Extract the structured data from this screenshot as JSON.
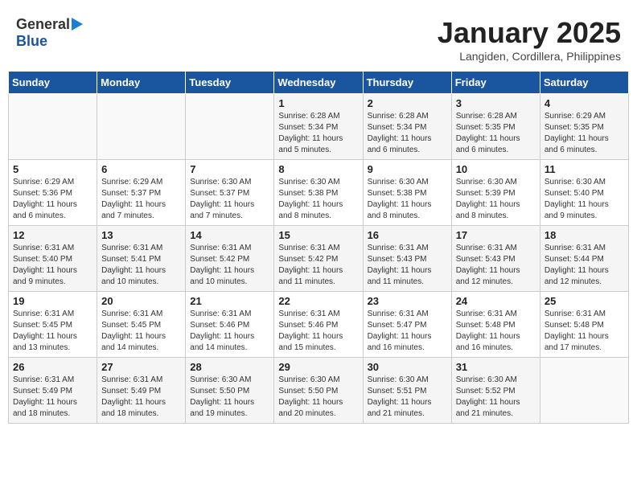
{
  "header": {
    "logo_general": "General",
    "logo_blue": "Blue",
    "month_title": "January 2025",
    "location": "Langiden, Cordillera, Philippines"
  },
  "weekdays": [
    "Sunday",
    "Monday",
    "Tuesday",
    "Wednesday",
    "Thursday",
    "Friday",
    "Saturday"
  ],
  "weeks": [
    [
      {
        "day": "",
        "sunrise": "",
        "sunset": "",
        "daylight": ""
      },
      {
        "day": "",
        "sunrise": "",
        "sunset": "",
        "daylight": ""
      },
      {
        "day": "",
        "sunrise": "",
        "sunset": "",
        "daylight": ""
      },
      {
        "day": "1",
        "sunrise": "Sunrise: 6:28 AM",
        "sunset": "Sunset: 5:34 PM",
        "daylight": "Daylight: 11 hours and 5 minutes."
      },
      {
        "day": "2",
        "sunrise": "Sunrise: 6:28 AM",
        "sunset": "Sunset: 5:34 PM",
        "daylight": "Daylight: 11 hours and 6 minutes."
      },
      {
        "day": "3",
        "sunrise": "Sunrise: 6:28 AM",
        "sunset": "Sunset: 5:35 PM",
        "daylight": "Daylight: 11 hours and 6 minutes."
      },
      {
        "day": "4",
        "sunrise": "Sunrise: 6:29 AM",
        "sunset": "Sunset: 5:35 PM",
        "daylight": "Daylight: 11 hours and 6 minutes."
      }
    ],
    [
      {
        "day": "5",
        "sunrise": "Sunrise: 6:29 AM",
        "sunset": "Sunset: 5:36 PM",
        "daylight": "Daylight: 11 hours and 6 minutes."
      },
      {
        "day": "6",
        "sunrise": "Sunrise: 6:29 AM",
        "sunset": "Sunset: 5:37 PM",
        "daylight": "Daylight: 11 hours and 7 minutes."
      },
      {
        "day": "7",
        "sunrise": "Sunrise: 6:30 AM",
        "sunset": "Sunset: 5:37 PM",
        "daylight": "Daylight: 11 hours and 7 minutes."
      },
      {
        "day": "8",
        "sunrise": "Sunrise: 6:30 AM",
        "sunset": "Sunset: 5:38 PM",
        "daylight": "Daylight: 11 hours and 8 minutes."
      },
      {
        "day": "9",
        "sunrise": "Sunrise: 6:30 AM",
        "sunset": "Sunset: 5:38 PM",
        "daylight": "Daylight: 11 hours and 8 minutes."
      },
      {
        "day": "10",
        "sunrise": "Sunrise: 6:30 AM",
        "sunset": "Sunset: 5:39 PM",
        "daylight": "Daylight: 11 hours and 8 minutes."
      },
      {
        "day": "11",
        "sunrise": "Sunrise: 6:30 AM",
        "sunset": "Sunset: 5:40 PM",
        "daylight": "Daylight: 11 hours and 9 minutes."
      }
    ],
    [
      {
        "day": "12",
        "sunrise": "Sunrise: 6:31 AM",
        "sunset": "Sunset: 5:40 PM",
        "daylight": "Daylight: 11 hours and 9 minutes."
      },
      {
        "day": "13",
        "sunrise": "Sunrise: 6:31 AM",
        "sunset": "Sunset: 5:41 PM",
        "daylight": "Daylight: 11 hours and 10 minutes."
      },
      {
        "day": "14",
        "sunrise": "Sunrise: 6:31 AM",
        "sunset": "Sunset: 5:42 PM",
        "daylight": "Daylight: 11 hours and 10 minutes."
      },
      {
        "day": "15",
        "sunrise": "Sunrise: 6:31 AM",
        "sunset": "Sunset: 5:42 PM",
        "daylight": "Daylight: 11 hours and 11 minutes."
      },
      {
        "day": "16",
        "sunrise": "Sunrise: 6:31 AM",
        "sunset": "Sunset: 5:43 PM",
        "daylight": "Daylight: 11 hours and 11 minutes."
      },
      {
        "day": "17",
        "sunrise": "Sunrise: 6:31 AM",
        "sunset": "Sunset: 5:43 PM",
        "daylight": "Daylight: 11 hours and 12 minutes."
      },
      {
        "day": "18",
        "sunrise": "Sunrise: 6:31 AM",
        "sunset": "Sunset: 5:44 PM",
        "daylight": "Daylight: 11 hours and 12 minutes."
      }
    ],
    [
      {
        "day": "19",
        "sunrise": "Sunrise: 6:31 AM",
        "sunset": "Sunset: 5:45 PM",
        "daylight": "Daylight: 11 hours and 13 minutes."
      },
      {
        "day": "20",
        "sunrise": "Sunrise: 6:31 AM",
        "sunset": "Sunset: 5:45 PM",
        "daylight": "Daylight: 11 hours and 14 minutes."
      },
      {
        "day": "21",
        "sunrise": "Sunrise: 6:31 AM",
        "sunset": "Sunset: 5:46 PM",
        "daylight": "Daylight: 11 hours and 14 minutes."
      },
      {
        "day": "22",
        "sunrise": "Sunrise: 6:31 AM",
        "sunset": "Sunset: 5:46 PM",
        "daylight": "Daylight: 11 hours and 15 minutes."
      },
      {
        "day": "23",
        "sunrise": "Sunrise: 6:31 AM",
        "sunset": "Sunset: 5:47 PM",
        "daylight": "Daylight: 11 hours and 16 minutes."
      },
      {
        "day": "24",
        "sunrise": "Sunrise: 6:31 AM",
        "sunset": "Sunset: 5:48 PM",
        "daylight": "Daylight: 11 hours and 16 minutes."
      },
      {
        "day": "25",
        "sunrise": "Sunrise: 6:31 AM",
        "sunset": "Sunset: 5:48 PM",
        "daylight": "Daylight: 11 hours and 17 minutes."
      }
    ],
    [
      {
        "day": "26",
        "sunrise": "Sunrise: 6:31 AM",
        "sunset": "Sunset: 5:49 PM",
        "daylight": "Daylight: 11 hours and 18 minutes."
      },
      {
        "day": "27",
        "sunrise": "Sunrise: 6:31 AM",
        "sunset": "Sunset: 5:49 PM",
        "daylight": "Daylight: 11 hours and 18 minutes."
      },
      {
        "day": "28",
        "sunrise": "Sunrise: 6:30 AM",
        "sunset": "Sunset: 5:50 PM",
        "daylight": "Daylight: 11 hours and 19 minutes."
      },
      {
        "day": "29",
        "sunrise": "Sunrise: 6:30 AM",
        "sunset": "Sunset: 5:50 PM",
        "daylight": "Daylight: 11 hours and 20 minutes."
      },
      {
        "day": "30",
        "sunrise": "Sunrise: 6:30 AM",
        "sunset": "Sunset: 5:51 PM",
        "daylight": "Daylight: 11 hours and 21 minutes."
      },
      {
        "day": "31",
        "sunrise": "Sunrise: 6:30 AM",
        "sunset": "Sunset: 5:52 PM",
        "daylight": "Daylight: 11 hours and 21 minutes."
      },
      {
        "day": "",
        "sunrise": "",
        "sunset": "",
        "daylight": ""
      }
    ]
  ]
}
